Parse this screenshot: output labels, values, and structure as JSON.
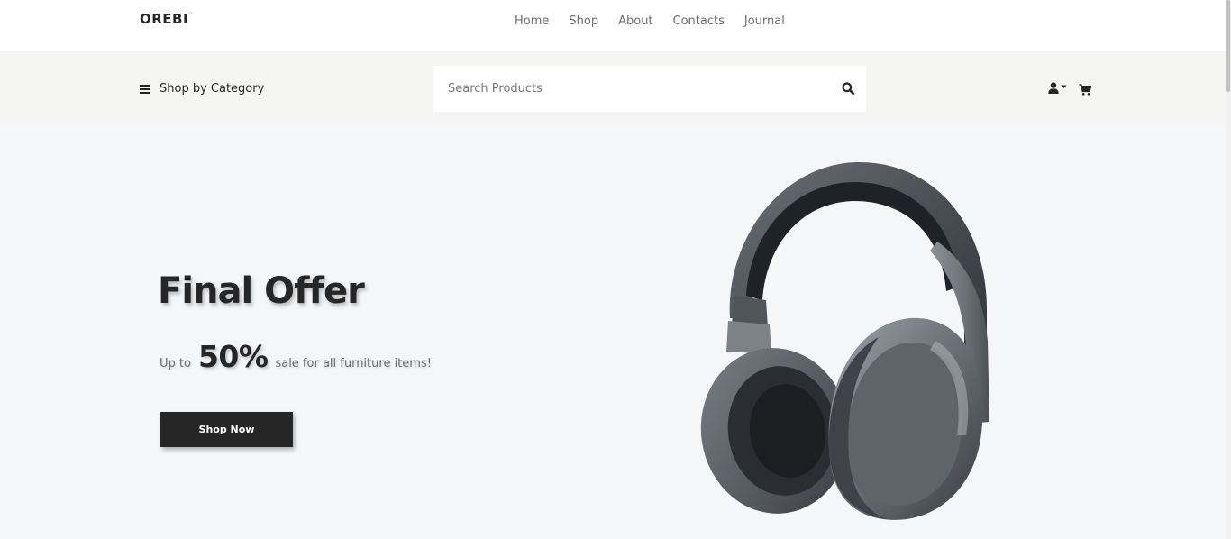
{
  "header": {
    "logo": "OREBI",
    "logo_mark": "™",
    "nav": [
      {
        "label": "Home"
      },
      {
        "label": "Shop"
      },
      {
        "label": "About"
      },
      {
        "label": "Contacts"
      },
      {
        "label": "Journal"
      }
    ]
  },
  "subbar": {
    "category_label": "Shop by Category",
    "search_placeholder": "Search Products",
    "icons": [
      "menu-icon",
      "search-icon",
      "user-icon",
      "caret-down-icon",
      "cart-icon"
    ]
  },
  "hero": {
    "title": "Final Offer",
    "subtitle_prefix": "Up to",
    "subtitle_value": "50%",
    "subtitle_suffix": "sale for all furniture items!",
    "cta_label": "Shop Now",
    "image": "headphones-product-image"
  },
  "colors": {
    "primary": "#262626",
    "muted_text": "#6d6d6d",
    "subbar_bg": "#f5f5f3",
    "hero_bg": "#f5f6f8"
  }
}
